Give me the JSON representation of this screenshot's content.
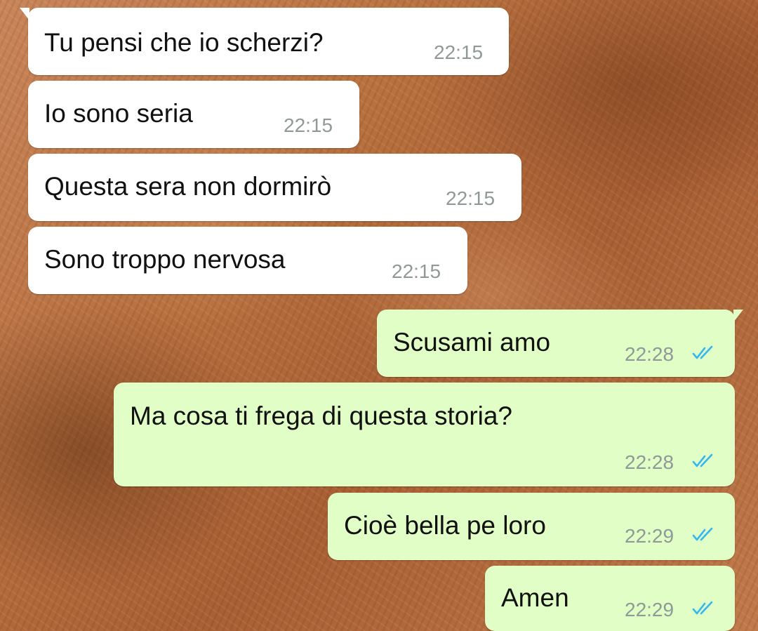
{
  "chat": {
    "messages": [
      {
        "direction": "incoming",
        "text": "Tu pensi che io scherzi?",
        "time": "22:15"
      },
      {
        "direction": "incoming",
        "text": "Io sono seria",
        "time": "22:15"
      },
      {
        "direction": "incoming",
        "text": "Questa sera non dormirò",
        "time": "22:15"
      },
      {
        "direction": "incoming",
        "text": "Sono troppo nervosa",
        "time": "22:15"
      },
      {
        "direction": "outgoing",
        "text": "Scusami amo",
        "time": "22:28",
        "status": "read"
      },
      {
        "direction": "outgoing",
        "text": "Ma cosa ti frega di questa storia?",
        "time": "22:28",
        "status": "read"
      },
      {
        "direction": "outgoing",
        "text": "Cioè bella pe loro",
        "time": "22:29",
        "status": "read"
      },
      {
        "direction": "outgoing",
        "text": "Amen",
        "time": "22:29",
        "status": "read"
      }
    ]
  },
  "colors": {
    "incoming_bubble": "#ffffff",
    "outgoing_bubble": "#e1fec6",
    "read_tick": "#34b7f1",
    "timestamp": "#8f9a98",
    "wallpaper": "#b8703f"
  },
  "icons": {
    "read_receipt": "double-check-icon"
  }
}
